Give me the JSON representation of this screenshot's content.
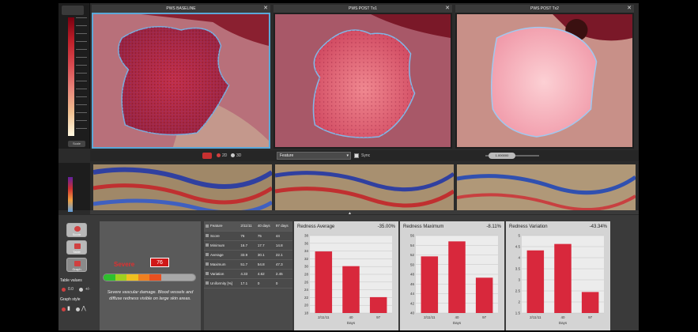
{
  "scale_button": "Scale",
  "panels": [
    {
      "title": "PWS BASELINE"
    },
    {
      "title": "PWS POST Tx1"
    },
    {
      "title": "PWS POST Tx2"
    }
  ],
  "toolbar": {
    "view_2d": "2D",
    "view_3d": "3D",
    "feature_select": "Feature",
    "sync_label": "Sync",
    "zoom_value": "1.000000"
  },
  "sidebar": {
    "buttons": [
      "Score",
      "Table",
      "Graph"
    ],
    "table_values_label": "Table values",
    "decimals": "0.0",
    "plusminus": "+/-",
    "graph_style_label": "Graph style"
  },
  "severity": {
    "label": "Severe",
    "score": "76",
    "description": "Severe vascular damage. Blood vessels and diffuse redness visible on large skin areas.",
    "colors": [
      "#2ec02e",
      "#a0d020",
      "#f0c020",
      "#f08020",
      "#e85020",
      "#a8a8a8",
      "#a8a8a8",
      "#a8a8a8"
    ]
  },
  "table": {
    "headers": [
      "Feature",
      "2/11/11",
      "40 days",
      "97 days"
    ],
    "rows": [
      [
        "Score",
        "76",
        "75",
        "44"
      ],
      [
        "Minimum",
        "16.7",
        "17.7",
        "14.8"
      ],
      [
        "Average",
        "33.9",
        "30.1",
        "22.1"
      ],
      [
        "Maximum",
        "51.7",
        "54.8",
        "47.3"
      ],
      [
        "Variation",
        "4.33",
        "4.62",
        "2.45"
      ],
      [
        "Uniformity [%]",
        "17.1",
        "0",
        "0"
      ]
    ]
  },
  "charts_meta": {
    "bar_color": "#d8283c"
  },
  "chart_data": [
    {
      "type": "bar",
      "title": "Redness Average",
      "change": "-35.00%",
      "categories": [
        "2/11/11",
        "40",
        "97"
      ],
      "values": [
        33.9,
        30.1,
        22.1
      ],
      "ylim": [
        18,
        38
      ],
      "yticks": [
        18,
        20,
        22,
        24,
        26,
        28,
        30,
        32,
        34,
        36,
        38
      ],
      "xlabel": "Days"
    },
    {
      "type": "bar",
      "title": "Redness Maximum",
      "change": "-8.11%",
      "categories": [
        "2/11/11",
        "40",
        "97"
      ],
      "values": [
        51.7,
        54.8,
        47.3
      ],
      "ylim": [
        40,
        56
      ],
      "yticks": [
        40,
        42,
        44,
        46,
        48,
        50,
        52,
        54,
        56
      ],
      "xlabel": "Days"
    },
    {
      "type": "bar",
      "title": "Redness Variation",
      "change": "-43.34%",
      "categories": [
        "2/11/11",
        "40",
        "97"
      ],
      "values": [
        4.33,
        4.62,
        2.45
      ],
      "ylim": [
        1.5,
        5
      ],
      "yticks": [
        1.5,
        2,
        2.5,
        3,
        3.5,
        4,
        4.5,
        5
      ],
      "xlabel": "Days"
    }
  ]
}
